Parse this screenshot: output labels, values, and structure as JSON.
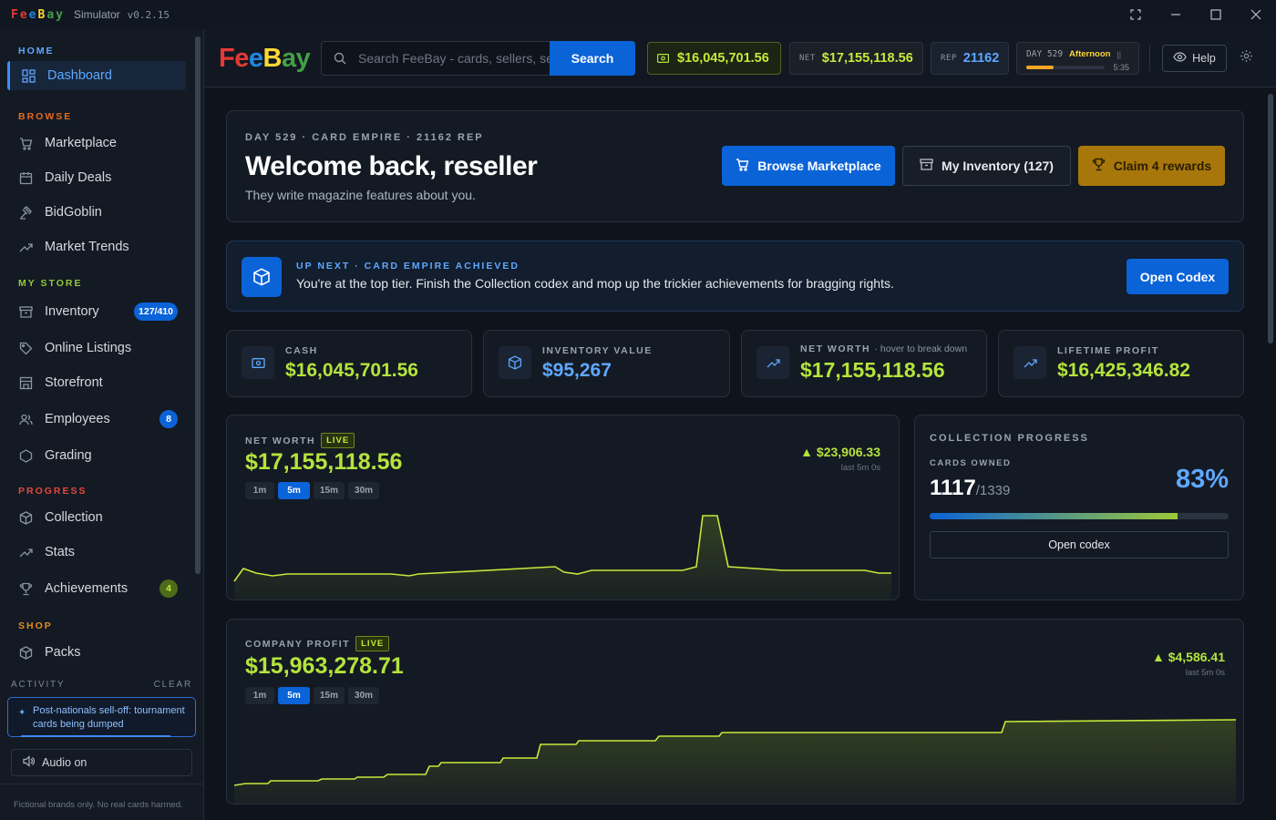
{
  "titlebar": {
    "logo": [
      "Fe",
      "e",
      "B",
      "ay"
    ],
    "app": "Simulator",
    "version": "v0.2.15"
  },
  "brand": {
    "parts": [
      "Fe",
      "e",
      "B",
      "ay"
    ],
    "colors": [
      "#e53935",
      "#1e88e5",
      "#fdd835",
      "#43a047"
    ]
  },
  "sidebar": {
    "sections": {
      "home": "HOME",
      "browse": "BROWSE",
      "mystore": "MY STORE",
      "progress": "PROGRESS",
      "shop": "SHOP"
    },
    "items": {
      "dashboard": "Dashboard",
      "marketplace": "Marketplace",
      "daily_deals": "Daily Deals",
      "bidgoblin": "BidGoblin",
      "market_trends": "Market Trends",
      "inventory": "Inventory",
      "online_listings": "Online Listings",
      "storefront": "Storefront",
      "employees": "Employees",
      "grading": "Grading",
      "collection": "Collection",
      "stats": "Stats",
      "achievements": "Achievements",
      "packs": "Packs"
    },
    "badges": {
      "inventory": "127/410",
      "employees": "8",
      "achievements": "4"
    },
    "activity": {
      "label": "ACTIVITY",
      "clear": "CLEAR",
      "message": "Post-nationals sell-off: tournament cards being dumped"
    },
    "audio": "Audio on",
    "footnote": "Fictional brands only. No real cards harmed."
  },
  "header": {
    "search_placeholder": "Search FeeBay - cards, sellers, sets",
    "search_button": "Search",
    "cash": "$16,045,701.56",
    "net_label": "NET",
    "net": "$17,155,118.56",
    "rep_label": "REP",
    "rep": "21162",
    "day": "DAY 529",
    "time_of_day": "Afternoon",
    "clock": "5:35",
    "day_progress": 0.35,
    "help": "Help"
  },
  "welcome": {
    "eyebrow": "DAY 529 · CARD EMPIRE · 21162 REP",
    "title": "Welcome back, reseller",
    "subtitle": "They write magazine features about you.",
    "browse_button": "Browse Marketplace",
    "inventory_button": "My Inventory (127)",
    "claim_button": "Claim 4 rewards"
  },
  "upnext": {
    "eyebrow": "UP NEXT · CARD EMPIRE ACHIEVED",
    "text": "You're at the top tier. Finish the Collection codex and mop up the trickier achievements for bragging rights.",
    "button": "Open Codex"
  },
  "stats": {
    "cash_label": "CASH",
    "cash": "$16,045,701.56",
    "inv_label": "INVENTORY VALUE",
    "inv": "$95,267",
    "net_label": "NET WORTH",
    "net_hint": "· hover to break down",
    "net": "$17,155,118.56",
    "profit_label": "LIFETIME PROFIT",
    "profit": "$16,425,346.82"
  },
  "networth_chart": {
    "label": "NET WORTH",
    "live": "LIVE",
    "value": "$17,155,118.56",
    "delta": "▲ $23,906.33",
    "delta_sub": "last 5m 0s",
    "timeframes": [
      "1m",
      "5m",
      "15m",
      "30m"
    ],
    "active_timeframe": "5m"
  },
  "company_chart": {
    "label": "COMPANY PROFIT",
    "live": "LIVE",
    "value": "$15,963,278.71",
    "delta": "▲ $4,586.41",
    "delta_sub": "last 5m 0s",
    "timeframes": [
      "1m",
      "5m",
      "15m",
      "30m"
    ],
    "active_timeframe": "5m"
  },
  "collection": {
    "label": "COLLECTION PROGRESS",
    "owned_label": "CARDS OWNED",
    "owned": "1117",
    "total": "/1339",
    "percent": "83%",
    "fraction": 0.83,
    "button": "Open codex"
  },
  "colors": {
    "accent_blue": "#0b63d8",
    "accent_green": "#b4e43c",
    "gold": "#a8770b",
    "orange": "#e46a1e"
  }
}
